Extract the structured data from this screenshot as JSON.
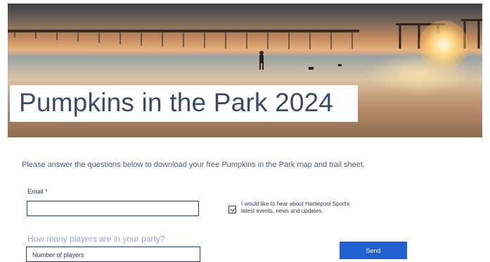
{
  "hero": {
    "title": "Pumpkins in the Park 2024"
  },
  "form": {
    "intro": "Please answer the questions below to download your free Pumpkins in the Park map and trail sheet.",
    "email_label": "Email *",
    "email_value": "",
    "consent_text": "I would like to hear about Hartlepool Sport's latest events, news and updates.",
    "consent_checked": true,
    "players_question": "How many players are in your party?",
    "players_placeholder": "Number of players",
    "send_label": "Send"
  },
  "colors": {
    "accent": "#1f5fd0",
    "title_text": "#3b4a6b",
    "intro_text": "#4a5d82"
  }
}
